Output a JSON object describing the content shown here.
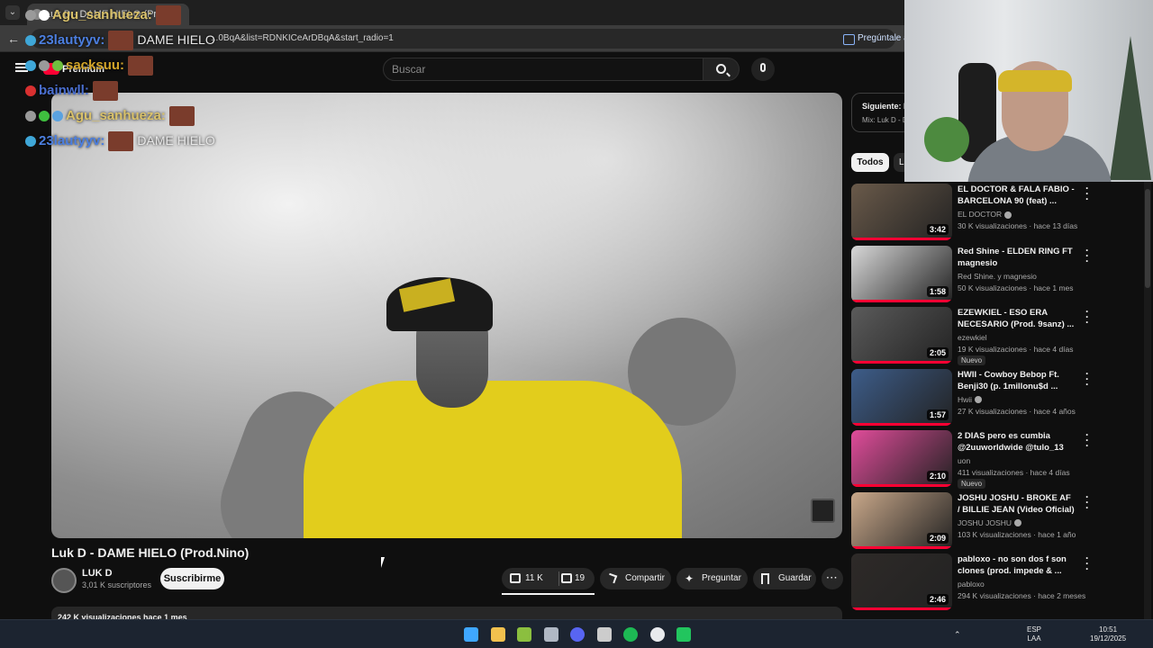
{
  "browser": {
    "tab_title": "Luk D - DAME HIELO (Pr...",
    "url": "...0BqA&list=RDNKICeArDBqA&start_radio=1",
    "ask_button": "Pregúntale a"
  },
  "youtube": {
    "premium_label": "Premium",
    "search_placeholder": "Buscar"
  },
  "chat": [
    {
      "user": "Agu_sanhueza:",
      "color": "#d9c16a",
      "message": "",
      "badges": [
        "#9a9a9a",
        "#ffffff"
      ]
    },
    {
      "user": "23lautyyv:",
      "color": "#4c7fe0",
      "message": "DAME HIELO",
      "badges": [
        "#3fa7d8"
      ]
    },
    {
      "user": "sacksuu:",
      "color": "#d4a629",
      "message": "",
      "badges": [
        "#3fa7d8",
        "#9a9a9a",
        "#6fbf3f"
      ]
    },
    {
      "user": "bainwll:",
      "color": "#4a6fd0",
      "message": "",
      "badges": [
        "#d93030"
      ]
    },
    {
      "user": "Agu_sanhueza:",
      "color": "#d9c16a",
      "message": "",
      "badges": [
        "#9a9a9a",
        "#3fbf3f",
        "#5aa2e0"
      ]
    },
    {
      "user": "23lautyyv:",
      "color": "#4c7fe0",
      "message": "DAME HIELO",
      "badges": [
        "#3fa7d8"
      ]
    }
  ],
  "video": {
    "title": "Luk D - DAME HIELO (Prod.Nino)",
    "channel": "LUK D",
    "subscribers": "3,01 K suscriptores",
    "subscribe_label": "Suscribirme",
    "likes": "11 K",
    "dislikes": "19",
    "share_label": "Compartir",
    "ask_label": "Preguntar",
    "save_label": "Guardar",
    "views_line": "242 K visualizaciones  hace 1 mes"
  },
  "sidebar": {
    "next_label": "Siguiente: E",
    "next_sub": "Mix: Luk D - D",
    "chip_all": "Todos",
    "chip_2": "L"
  },
  "recommendations": [
    {
      "title": "EL DOCTOR & FALA FABIO - BARCELONA 90 (feat) ...",
      "channel": "EL DOCTOR",
      "verified": true,
      "meta": "30 K visualizaciones · hace 13 días",
      "duration": "3:42",
      "badge": "",
      "thumb": "#6a5a4a"
    },
    {
      "title": "Red Shine - ELDEN RING FT magnesio",
      "channel": "Red Shine. y magnesio",
      "verified": false,
      "meta": "50 K visualizaciones · hace 1 mes",
      "duration": "1:58",
      "badge": "",
      "thumb": "#d8d8d8"
    },
    {
      "title": "EZEWKIEL - ESO ERA NECESARIO (Prod. 9sanz) ...",
      "channel": "ezewkiel",
      "verified": false,
      "meta": "19 K visualizaciones · hace 4 días",
      "duration": "2:05",
      "badge": "Nuevo",
      "thumb": "#5b5b5b"
    },
    {
      "title": "HWII - Cowboy Bebop Ft. Benji30 (p. 1millonu$d ...",
      "channel": "Hwii",
      "verified": true,
      "meta": "27 K visualizaciones · hace 4 años",
      "duration": "1:57",
      "badge": "",
      "thumb": "#3d5d8a"
    },
    {
      "title": "2 DIAS pero es cumbia @2uuworldwide @tulo_13",
      "channel": "uon",
      "verified": false,
      "meta": "411 visualizaciones · hace 4 días",
      "duration": "2:10",
      "badge": "Nuevo",
      "thumb": "#e04c9a"
    },
    {
      "title": "JOSHU JOSHU - BROKE AF / BILLIE JEAN (Video Oficial)",
      "channel": "JOSHU JOSHU",
      "verified": true,
      "meta": "103 K visualizaciones · hace 1 año",
      "duration": "2:09",
      "badge": "",
      "thumb": "#c9a88a"
    },
    {
      "title": "pabloxo - no son dos f son clones (prod. impede & ...",
      "channel": "pabloxo",
      "verified": false,
      "meta": "294 K visualizaciones · hace 2 meses",
      "duration": "2:46",
      "badge": "",
      "thumb": "#2e2a28"
    }
  ],
  "taskbar": {
    "language": "ESP",
    "language_sub": "LAA",
    "time": "10:51",
    "date": "19/12/2025",
    "icon_colors": [
      "#3fa7ff",
      "#f2c14e",
      "#8bbf3f",
      "#b0b8c4",
      "#5865f2",
      "#cccccc",
      "#1db954",
      "#e8eaed",
      "#22c55e"
    ]
  }
}
